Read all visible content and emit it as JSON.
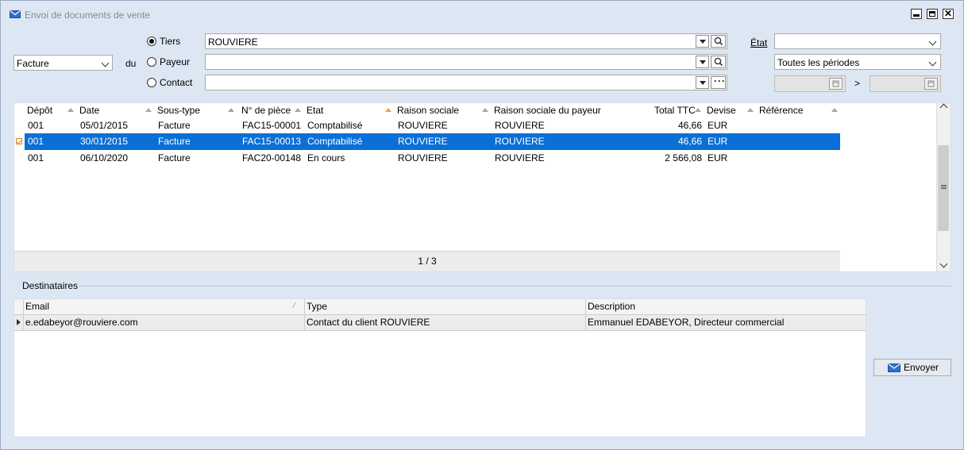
{
  "window": {
    "title": "Envoi de documents de vente",
    "icons": {
      "title": "envelope-icon",
      "minimize": "minimize-icon",
      "maximize": "maximize-icon",
      "close": "close-icon"
    }
  },
  "filters": {
    "doc_type": "Facture",
    "du_label": "du",
    "radios": [
      {
        "label": "Tiers",
        "selected": true,
        "value": "ROUVIERE"
      },
      {
        "label": "Payeur",
        "selected": false,
        "value": ""
      },
      {
        "label": "Contact",
        "selected": false,
        "value": ""
      }
    ],
    "etat_label": "État",
    "etat_value": "",
    "period_value": "Toutes les périodes",
    "date_from": "",
    "date_to": "",
    "date_separator": ">"
  },
  "documents": {
    "columns": [
      "Dépôt",
      "Date",
      "Sous-type",
      "N° de pièce",
      "Etat",
      "Raison sociale",
      "Raison sociale du payeur",
      "Total TTC",
      "Devise",
      "Référence"
    ],
    "sorted_column": "Etat",
    "rows": [
      {
        "depot": "001",
        "date": "05/01/2015",
        "soustype": "Facture",
        "piece": "FAC15-00001",
        "etat": "Comptabilisé",
        "raison": "ROUVIERE",
        "raison_payeur": "ROUVIERE",
        "total": "46,66",
        "devise": "EUR",
        "reference": "",
        "selected": false
      },
      {
        "depot": "001",
        "date": "30/01/2015",
        "soustype": "Facture",
        "piece": "FAC15-00013",
        "etat": "Comptabilisé",
        "raison": "ROUVIERE",
        "raison_payeur": "ROUVIERE",
        "total": "46,66",
        "devise": "EUR",
        "reference": "",
        "selected": true
      },
      {
        "depot": "001",
        "date": "06/10/2020",
        "soustype": "Facture",
        "piece": "FAC20-00148",
        "etat": "En cours",
        "raison": "ROUVIERE",
        "raison_payeur": "ROUVIERE",
        "total": "2 566,08",
        "devise": "EUR",
        "reference": "",
        "selected": false
      }
    ],
    "pager": "1 / 3"
  },
  "destinataires": {
    "section_label": "Destinataires",
    "columns": [
      "Email",
      "Type",
      "Description"
    ],
    "rows": [
      {
        "email": "e.edabeyor@rouviere.com",
        "type": "Contact du client ROUVIERE",
        "description": "Emmanuel EDABEYOR, Directeur commercial"
      }
    ]
  },
  "actions": {
    "send_label": "Envoyer",
    "send_icon": "envelope-icon"
  },
  "colors": {
    "selection": "#0a6fd6",
    "window_bg": "#dde7f4",
    "sort_active": "#f0a035"
  }
}
